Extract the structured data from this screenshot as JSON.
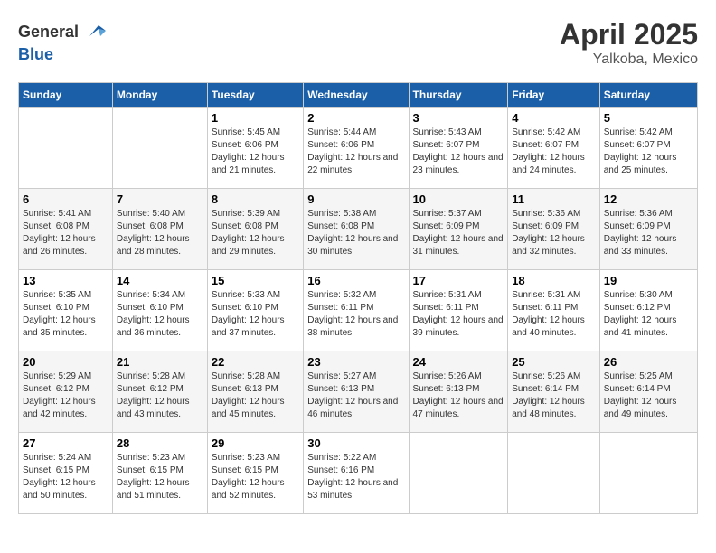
{
  "logo": {
    "general": "General",
    "blue": "Blue"
  },
  "title": "April 2025",
  "subtitle": "Yalkoba, Mexico",
  "days_of_week": [
    "Sunday",
    "Monday",
    "Tuesday",
    "Wednesday",
    "Thursday",
    "Friday",
    "Saturday"
  ],
  "weeks": [
    [
      {
        "day": "",
        "sunrise": "",
        "sunset": "",
        "daylight": ""
      },
      {
        "day": "",
        "sunrise": "",
        "sunset": "",
        "daylight": ""
      },
      {
        "day": "1",
        "sunrise": "Sunrise: 5:45 AM",
        "sunset": "Sunset: 6:06 PM",
        "daylight": "Daylight: 12 hours and 21 minutes."
      },
      {
        "day": "2",
        "sunrise": "Sunrise: 5:44 AM",
        "sunset": "Sunset: 6:06 PM",
        "daylight": "Daylight: 12 hours and 22 minutes."
      },
      {
        "day": "3",
        "sunrise": "Sunrise: 5:43 AM",
        "sunset": "Sunset: 6:07 PM",
        "daylight": "Daylight: 12 hours and 23 minutes."
      },
      {
        "day": "4",
        "sunrise": "Sunrise: 5:42 AM",
        "sunset": "Sunset: 6:07 PM",
        "daylight": "Daylight: 12 hours and 24 minutes."
      },
      {
        "day": "5",
        "sunrise": "Sunrise: 5:42 AM",
        "sunset": "Sunset: 6:07 PM",
        "daylight": "Daylight: 12 hours and 25 minutes."
      }
    ],
    [
      {
        "day": "6",
        "sunrise": "Sunrise: 5:41 AM",
        "sunset": "Sunset: 6:08 PM",
        "daylight": "Daylight: 12 hours and 26 minutes."
      },
      {
        "day": "7",
        "sunrise": "Sunrise: 5:40 AM",
        "sunset": "Sunset: 6:08 PM",
        "daylight": "Daylight: 12 hours and 28 minutes."
      },
      {
        "day": "8",
        "sunrise": "Sunrise: 5:39 AM",
        "sunset": "Sunset: 6:08 PM",
        "daylight": "Daylight: 12 hours and 29 minutes."
      },
      {
        "day": "9",
        "sunrise": "Sunrise: 5:38 AM",
        "sunset": "Sunset: 6:08 PM",
        "daylight": "Daylight: 12 hours and 30 minutes."
      },
      {
        "day": "10",
        "sunrise": "Sunrise: 5:37 AM",
        "sunset": "Sunset: 6:09 PM",
        "daylight": "Daylight: 12 hours and 31 minutes."
      },
      {
        "day": "11",
        "sunrise": "Sunrise: 5:36 AM",
        "sunset": "Sunset: 6:09 PM",
        "daylight": "Daylight: 12 hours and 32 minutes."
      },
      {
        "day": "12",
        "sunrise": "Sunrise: 5:36 AM",
        "sunset": "Sunset: 6:09 PM",
        "daylight": "Daylight: 12 hours and 33 minutes."
      }
    ],
    [
      {
        "day": "13",
        "sunrise": "Sunrise: 5:35 AM",
        "sunset": "Sunset: 6:10 PM",
        "daylight": "Daylight: 12 hours and 35 minutes."
      },
      {
        "day": "14",
        "sunrise": "Sunrise: 5:34 AM",
        "sunset": "Sunset: 6:10 PM",
        "daylight": "Daylight: 12 hours and 36 minutes."
      },
      {
        "day": "15",
        "sunrise": "Sunrise: 5:33 AM",
        "sunset": "Sunset: 6:10 PM",
        "daylight": "Daylight: 12 hours and 37 minutes."
      },
      {
        "day": "16",
        "sunrise": "Sunrise: 5:32 AM",
        "sunset": "Sunset: 6:11 PM",
        "daylight": "Daylight: 12 hours and 38 minutes."
      },
      {
        "day": "17",
        "sunrise": "Sunrise: 5:31 AM",
        "sunset": "Sunset: 6:11 PM",
        "daylight": "Daylight: 12 hours and 39 minutes."
      },
      {
        "day": "18",
        "sunrise": "Sunrise: 5:31 AM",
        "sunset": "Sunset: 6:11 PM",
        "daylight": "Daylight: 12 hours and 40 minutes."
      },
      {
        "day": "19",
        "sunrise": "Sunrise: 5:30 AM",
        "sunset": "Sunset: 6:12 PM",
        "daylight": "Daylight: 12 hours and 41 minutes."
      }
    ],
    [
      {
        "day": "20",
        "sunrise": "Sunrise: 5:29 AM",
        "sunset": "Sunset: 6:12 PM",
        "daylight": "Daylight: 12 hours and 42 minutes."
      },
      {
        "day": "21",
        "sunrise": "Sunrise: 5:28 AM",
        "sunset": "Sunset: 6:12 PM",
        "daylight": "Daylight: 12 hours and 43 minutes."
      },
      {
        "day": "22",
        "sunrise": "Sunrise: 5:28 AM",
        "sunset": "Sunset: 6:13 PM",
        "daylight": "Daylight: 12 hours and 45 minutes."
      },
      {
        "day": "23",
        "sunrise": "Sunrise: 5:27 AM",
        "sunset": "Sunset: 6:13 PM",
        "daylight": "Daylight: 12 hours and 46 minutes."
      },
      {
        "day": "24",
        "sunrise": "Sunrise: 5:26 AM",
        "sunset": "Sunset: 6:13 PM",
        "daylight": "Daylight: 12 hours and 47 minutes."
      },
      {
        "day": "25",
        "sunrise": "Sunrise: 5:26 AM",
        "sunset": "Sunset: 6:14 PM",
        "daylight": "Daylight: 12 hours and 48 minutes."
      },
      {
        "day": "26",
        "sunrise": "Sunrise: 5:25 AM",
        "sunset": "Sunset: 6:14 PM",
        "daylight": "Daylight: 12 hours and 49 minutes."
      }
    ],
    [
      {
        "day": "27",
        "sunrise": "Sunrise: 5:24 AM",
        "sunset": "Sunset: 6:15 PM",
        "daylight": "Daylight: 12 hours and 50 minutes."
      },
      {
        "day": "28",
        "sunrise": "Sunrise: 5:23 AM",
        "sunset": "Sunset: 6:15 PM",
        "daylight": "Daylight: 12 hours and 51 minutes."
      },
      {
        "day": "29",
        "sunrise": "Sunrise: 5:23 AM",
        "sunset": "Sunset: 6:15 PM",
        "daylight": "Daylight: 12 hours and 52 minutes."
      },
      {
        "day": "30",
        "sunrise": "Sunrise: 5:22 AM",
        "sunset": "Sunset: 6:16 PM",
        "daylight": "Daylight: 12 hours and 53 minutes."
      },
      {
        "day": "",
        "sunrise": "",
        "sunset": "",
        "daylight": ""
      },
      {
        "day": "",
        "sunrise": "",
        "sunset": "",
        "daylight": ""
      },
      {
        "day": "",
        "sunrise": "",
        "sunset": "",
        "daylight": ""
      }
    ]
  ]
}
